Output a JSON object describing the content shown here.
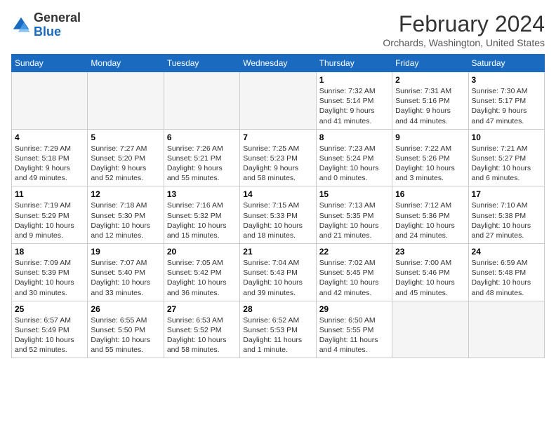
{
  "header": {
    "logo_general": "General",
    "logo_blue": "Blue",
    "month_year": "February 2024",
    "location": "Orchards, Washington, United States"
  },
  "days_of_week": [
    "Sunday",
    "Monday",
    "Tuesday",
    "Wednesday",
    "Thursday",
    "Friday",
    "Saturday"
  ],
  "weeks": [
    [
      {
        "day": "",
        "info": ""
      },
      {
        "day": "",
        "info": ""
      },
      {
        "day": "",
        "info": ""
      },
      {
        "day": "",
        "info": ""
      },
      {
        "day": "1",
        "info": "Sunrise: 7:32 AM\nSunset: 5:14 PM\nDaylight: 9 hours\nand 41 minutes."
      },
      {
        "day": "2",
        "info": "Sunrise: 7:31 AM\nSunset: 5:16 PM\nDaylight: 9 hours\nand 44 minutes."
      },
      {
        "day": "3",
        "info": "Sunrise: 7:30 AM\nSunset: 5:17 PM\nDaylight: 9 hours\nand 47 minutes."
      }
    ],
    [
      {
        "day": "4",
        "info": "Sunrise: 7:29 AM\nSunset: 5:18 PM\nDaylight: 9 hours\nand 49 minutes."
      },
      {
        "day": "5",
        "info": "Sunrise: 7:27 AM\nSunset: 5:20 PM\nDaylight: 9 hours\nand 52 minutes."
      },
      {
        "day": "6",
        "info": "Sunrise: 7:26 AM\nSunset: 5:21 PM\nDaylight: 9 hours\nand 55 minutes."
      },
      {
        "day": "7",
        "info": "Sunrise: 7:25 AM\nSunset: 5:23 PM\nDaylight: 9 hours\nand 58 minutes."
      },
      {
        "day": "8",
        "info": "Sunrise: 7:23 AM\nSunset: 5:24 PM\nDaylight: 10 hours\nand 0 minutes."
      },
      {
        "day": "9",
        "info": "Sunrise: 7:22 AM\nSunset: 5:26 PM\nDaylight: 10 hours\nand 3 minutes."
      },
      {
        "day": "10",
        "info": "Sunrise: 7:21 AM\nSunset: 5:27 PM\nDaylight: 10 hours\nand 6 minutes."
      }
    ],
    [
      {
        "day": "11",
        "info": "Sunrise: 7:19 AM\nSunset: 5:29 PM\nDaylight: 10 hours\nand 9 minutes."
      },
      {
        "day": "12",
        "info": "Sunrise: 7:18 AM\nSunset: 5:30 PM\nDaylight: 10 hours\nand 12 minutes."
      },
      {
        "day": "13",
        "info": "Sunrise: 7:16 AM\nSunset: 5:32 PM\nDaylight: 10 hours\nand 15 minutes."
      },
      {
        "day": "14",
        "info": "Sunrise: 7:15 AM\nSunset: 5:33 PM\nDaylight: 10 hours\nand 18 minutes."
      },
      {
        "day": "15",
        "info": "Sunrise: 7:13 AM\nSunset: 5:35 PM\nDaylight: 10 hours\nand 21 minutes."
      },
      {
        "day": "16",
        "info": "Sunrise: 7:12 AM\nSunset: 5:36 PM\nDaylight: 10 hours\nand 24 minutes."
      },
      {
        "day": "17",
        "info": "Sunrise: 7:10 AM\nSunset: 5:38 PM\nDaylight: 10 hours\nand 27 minutes."
      }
    ],
    [
      {
        "day": "18",
        "info": "Sunrise: 7:09 AM\nSunset: 5:39 PM\nDaylight: 10 hours\nand 30 minutes."
      },
      {
        "day": "19",
        "info": "Sunrise: 7:07 AM\nSunset: 5:40 PM\nDaylight: 10 hours\nand 33 minutes."
      },
      {
        "day": "20",
        "info": "Sunrise: 7:05 AM\nSunset: 5:42 PM\nDaylight: 10 hours\nand 36 minutes."
      },
      {
        "day": "21",
        "info": "Sunrise: 7:04 AM\nSunset: 5:43 PM\nDaylight: 10 hours\nand 39 minutes."
      },
      {
        "day": "22",
        "info": "Sunrise: 7:02 AM\nSunset: 5:45 PM\nDaylight: 10 hours\nand 42 minutes."
      },
      {
        "day": "23",
        "info": "Sunrise: 7:00 AM\nSunset: 5:46 PM\nDaylight: 10 hours\nand 45 minutes."
      },
      {
        "day": "24",
        "info": "Sunrise: 6:59 AM\nSunset: 5:48 PM\nDaylight: 10 hours\nand 48 minutes."
      }
    ],
    [
      {
        "day": "25",
        "info": "Sunrise: 6:57 AM\nSunset: 5:49 PM\nDaylight: 10 hours\nand 52 minutes."
      },
      {
        "day": "26",
        "info": "Sunrise: 6:55 AM\nSunset: 5:50 PM\nDaylight: 10 hours\nand 55 minutes."
      },
      {
        "day": "27",
        "info": "Sunrise: 6:53 AM\nSunset: 5:52 PM\nDaylight: 10 hours\nand 58 minutes."
      },
      {
        "day": "28",
        "info": "Sunrise: 6:52 AM\nSunset: 5:53 PM\nDaylight: 11 hours\nand 1 minute."
      },
      {
        "day": "29",
        "info": "Sunrise: 6:50 AM\nSunset: 5:55 PM\nDaylight: 11 hours\nand 4 minutes."
      },
      {
        "day": "",
        "info": ""
      },
      {
        "day": "",
        "info": ""
      }
    ]
  ]
}
